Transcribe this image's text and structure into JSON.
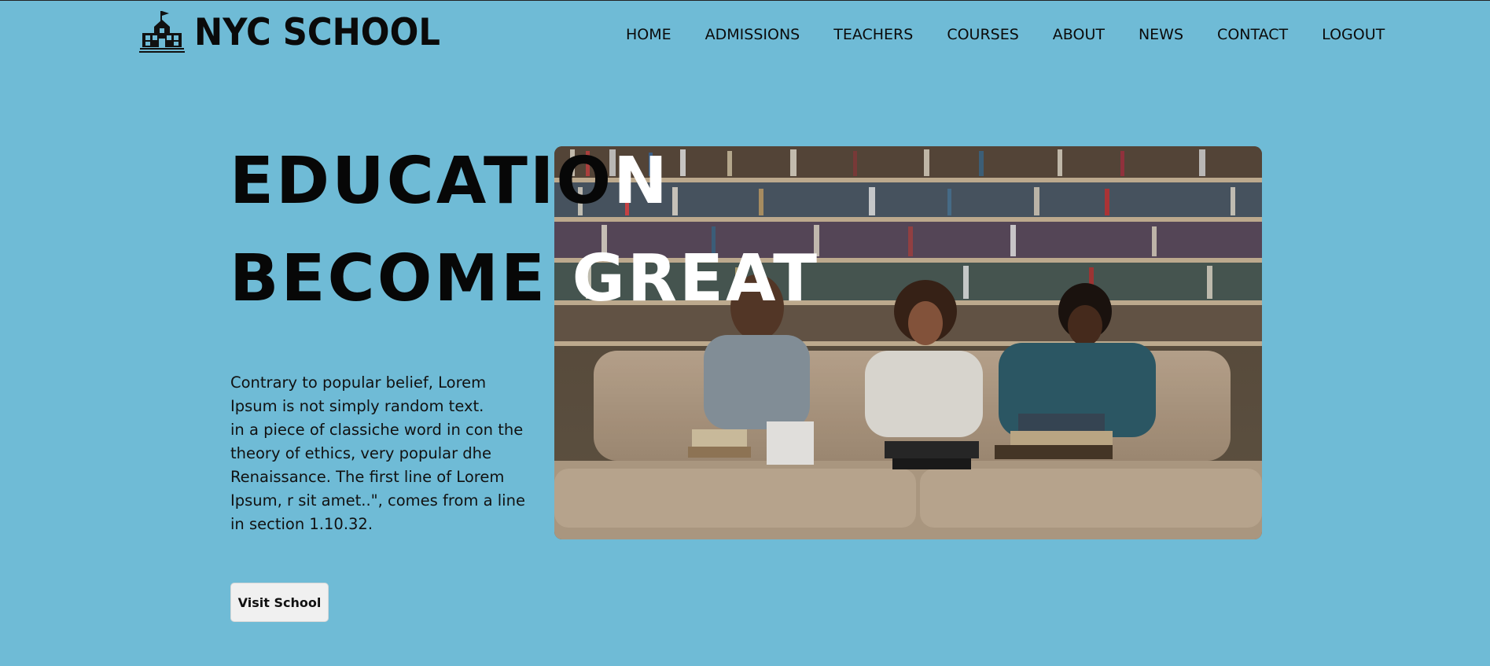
{
  "header": {
    "brand": "NYC SCHOOL",
    "logo_icon": "school-building-icon",
    "nav": [
      "HOME",
      "ADMISSIONS",
      "TEACHERS",
      "COURSES",
      "ABOUT",
      "NEWS",
      "CONTACT",
      "LOGOUT"
    ]
  },
  "hero": {
    "line1_dark": "EDUCATIO",
    "line1_light": "N",
    "line2_dark": "BECOME ",
    "line2_light": "GREAT",
    "paragraph_lines": [
      "Contrary to popular belief, Lorem",
      "Ipsum is not simply random text.",
      "in a piece of classiche word in con the",
      "theory of ethics, very popular dhe",
      "Renaissance. The first line of Lorem",
      "Ipsum, r sit amet..\", comes from a line",
      "in section 1.10.32."
    ],
    "button_label": "Visit School",
    "image_subject": "students-studying-in-library-photo"
  },
  "colors": {
    "background": "#6fbbd6",
    "text": "#0b0b0b",
    "headline_highlight": "#ffffff",
    "button_bg": "#f0f0f0"
  }
}
